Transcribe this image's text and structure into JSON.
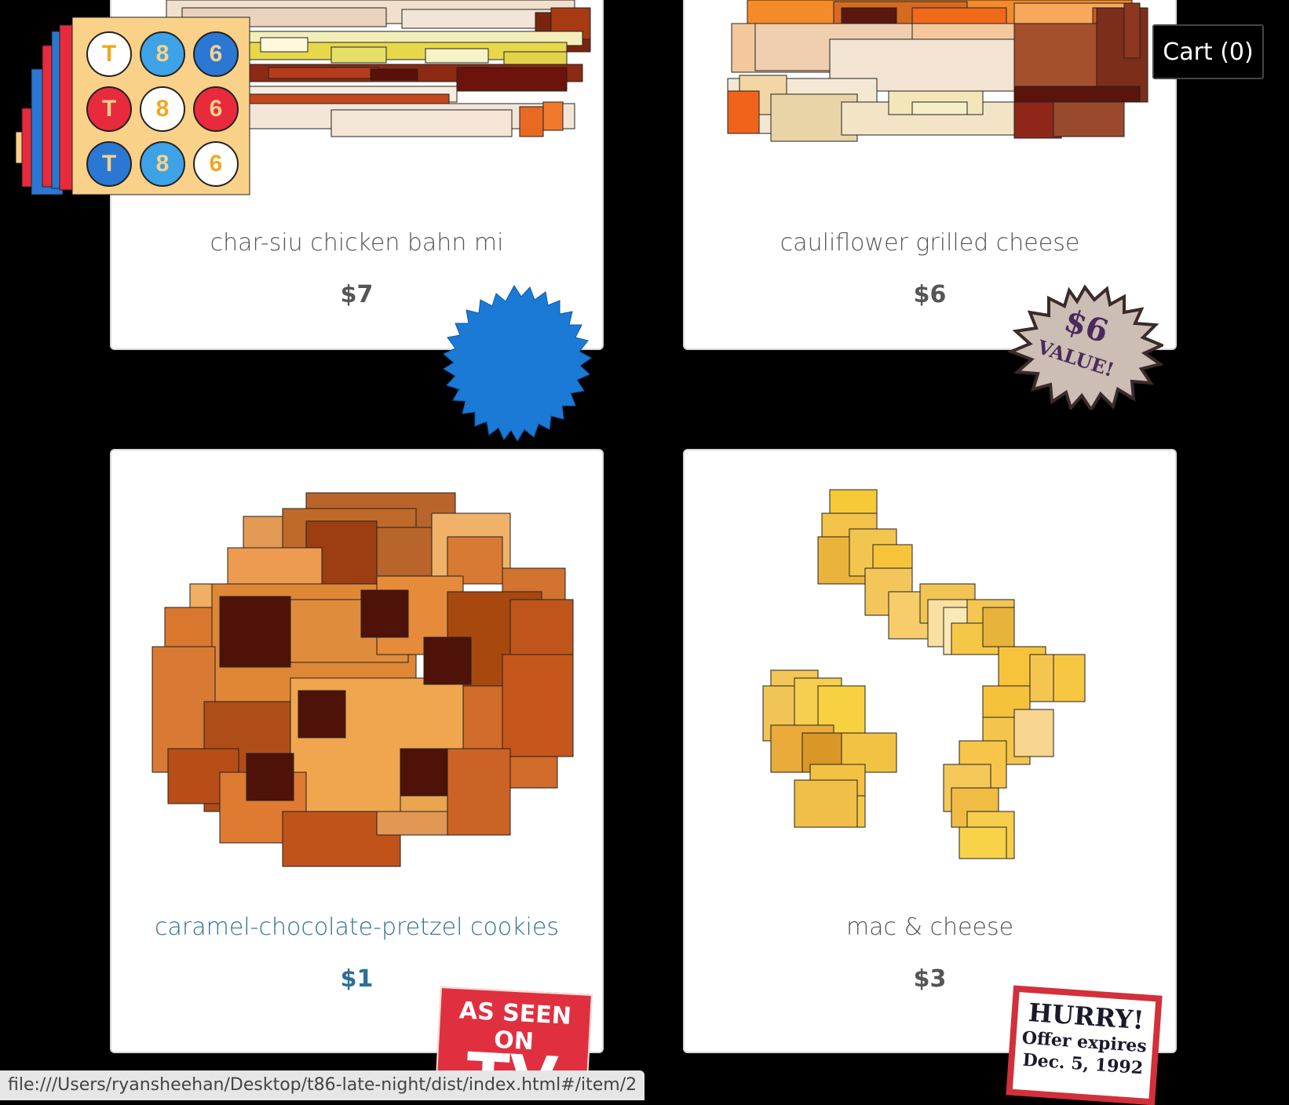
{
  "header": {
    "cart_label": "Cart (0)"
  },
  "logo": {
    "letters": [
      "T",
      "8",
      "6"
    ]
  },
  "menu": {
    "items": [
      {
        "name": "char-siu chicken bahn mi",
        "price": "$7"
      },
      {
        "name": "cauliflower grilled cheese",
        "price": "$6"
      },
      {
        "name": "caramel-chocolate-pretzel cookies",
        "price": "$1"
      },
      {
        "name": "mac & cheese",
        "price": "$3"
      }
    ]
  },
  "stickers": {
    "value_top": "$6",
    "value_bottom": "VALUE!",
    "tv_text": "AS SEEN ON",
    "tv_big": "TV",
    "hurry_1": "HURRY!",
    "hurry_2": "Offer expires",
    "hurry_3": "Dec. 5, 1992"
  },
  "status_bar": {
    "url": "file:///Users/ryansheehan/Desktop/t86-late-night/dist/index.html#/item/2"
  },
  "colors": {
    "active_text": "#2d6f9b",
    "text": "#555555",
    "badge_blue": "#1a7ad6"
  }
}
